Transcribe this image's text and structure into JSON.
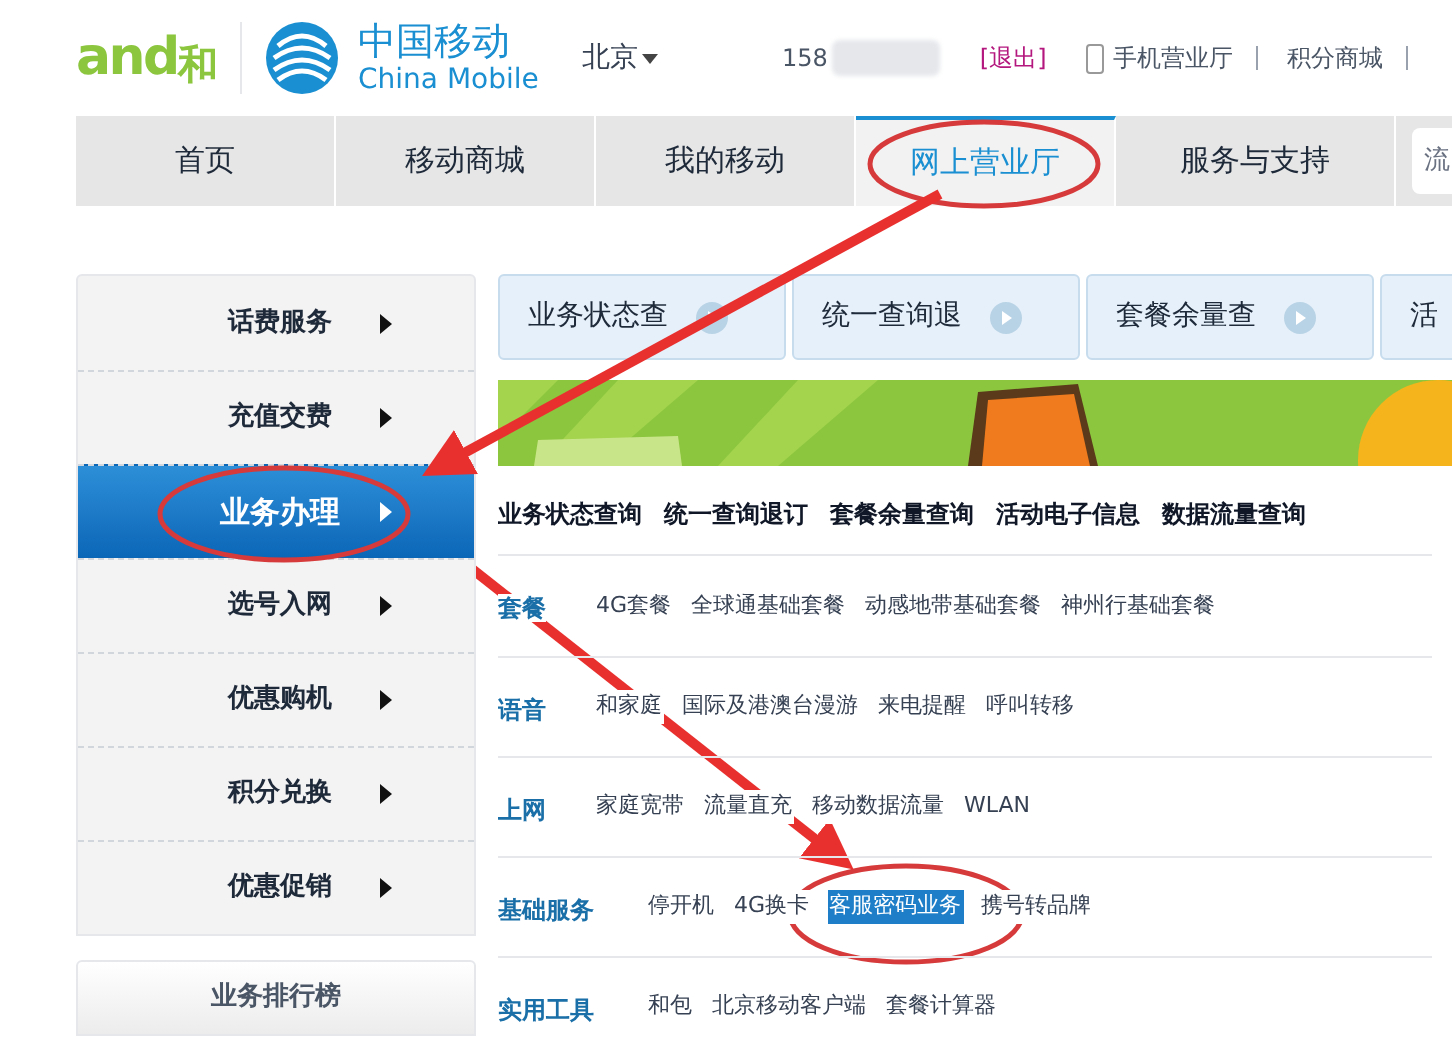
{
  "header": {
    "logo": {
      "mark": "and",
      "name": "和"
    },
    "brand": {
      "cn": "中国移动",
      "en": "China Mobile"
    },
    "city": "北京",
    "user": "158",
    "logout": "[退出]",
    "links": [
      "手机营业厅",
      "积分商城"
    ]
  },
  "nav": {
    "tabs": [
      {
        "label": "首页",
        "selected": false
      },
      {
        "label": "移动商城",
        "selected": false
      },
      {
        "label": "我的移动",
        "selected": false
      },
      {
        "label": "网上营业厅",
        "selected": true
      },
      {
        "label": "服务与支持",
        "selected": false
      }
    ],
    "search": {
      "placeholder": "流"
    }
  },
  "sidebar": {
    "items": [
      {
        "label": "话费服务",
        "selected": false
      },
      {
        "label": "充值交费",
        "selected": false
      },
      {
        "label": "业务办理",
        "selected": true
      },
      {
        "label": "选号入网",
        "selected": false
      },
      {
        "label": "优惠购机",
        "selected": false
      },
      {
        "label": "积分兑换",
        "selected": false
      },
      {
        "label": "优惠促销",
        "selected": false
      }
    ],
    "ranking_title": "业务排行榜"
  },
  "quick_buttons": [
    "业务状态查",
    "统一查询退",
    "套餐余量查",
    "活"
  ],
  "quick_links": [
    "业务状态查询",
    "统一查询退订",
    "套餐余量查询",
    "活动电子信息",
    "数据流量查询"
  ],
  "categories": [
    {
      "label": "套餐",
      "items": [
        {
          "label": "4G套餐",
          "selected": false
        },
        {
          "label": "全球通基础套餐",
          "selected": false
        },
        {
          "label": "动感地带基础套餐",
          "selected": false
        },
        {
          "label": "神州行基础套餐",
          "selected": false
        }
      ]
    },
    {
      "label": "语音",
      "items": [
        {
          "label": "和家庭",
          "selected": false
        },
        {
          "label": "国际及港澳台漫游",
          "selected": false
        },
        {
          "label": "来电提醒",
          "selected": false
        },
        {
          "label": "呼叫转移",
          "selected": false
        }
      ]
    },
    {
      "label": "上网",
      "items": [
        {
          "label": "家庭宽带",
          "selected": false
        },
        {
          "label": "流量直充",
          "selected": false
        },
        {
          "label": "移动数据流量",
          "selected": false
        },
        {
          "label": "WLAN",
          "selected": false
        }
      ]
    },
    {
      "label": "基础服务",
      "items": [
        {
          "label": "停开机",
          "selected": false
        },
        {
          "label": "4G换卡",
          "selected": false
        },
        {
          "label": "客服密码业务",
          "selected": true
        },
        {
          "label": "携号转品牌",
          "selected": false
        }
      ]
    },
    {
      "label": "实用工具",
      "items": [
        {
          "label": "和包",
          "selected": false
        },
        {
          "label": "北京移动客户端",
          "selected": false
        },
        {
          "label": "套餐计算器",
          "selected": false
        }
      ]
    }
  ]
}
